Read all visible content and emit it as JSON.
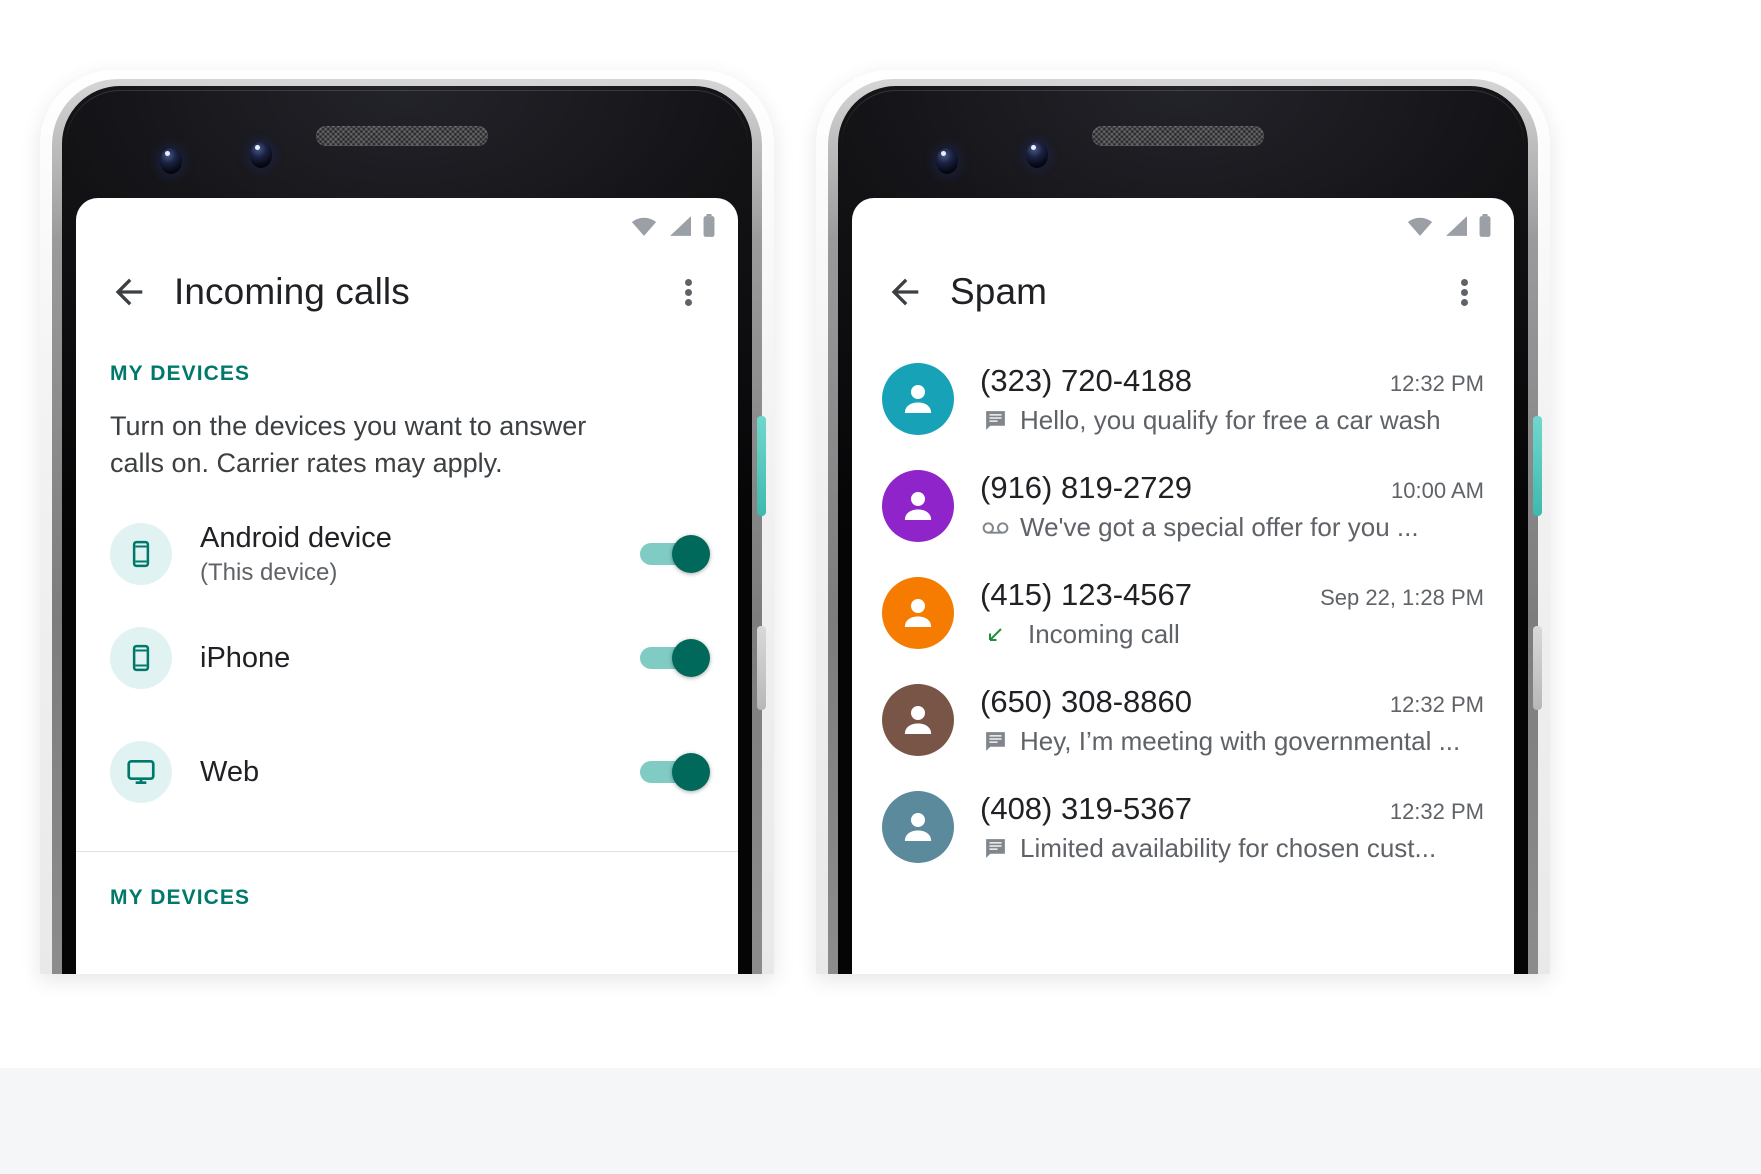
{
  "colors": {
    "accent_teal": "#00796b",
    "toggle_track": "#80cbc4",
    "toggle_thumb": "#00695c",
    "icon_bg": "#e0f2f1",
    "text_primary": "#202124",
    "text_secondary": "#5f6368",
    "incoming_arrow_green": "#1e8e3e"
  },
  "status_bar": {
    "icons": [
      "wifi-icon",
      "cell-signal-icon",
      "battery-icon"
    ]
  },
  "left_phone": {
    "appbar": {
      "back_icon": "arrow-back-icon",
      "title": "Incoming calls",
      "overflow_icon": "more-vert-icon"
    },
    "section_label": "MY DEVICES",
    "description": "Turn on the devices you want to answer calls on. Carrier rates may apply.",
    "devices": [
      {
        "icon": "smartphone-icon",
        "name": "Android device",
        "sub": "(This device)",
        "toggle_on": true
      },
      {
        "icon": "smartphone-icon",
        "name": "iPhone",
        "sub": "",
        "toggle_on": true
      },
      {
        "icon": "desktop-icon",
        "name": "Web",
        "sub": "",
        "toggle_on": true
      }
    ],
    "second_section_label": "MY DEVICES"
  },
  "right_phone": {
    "appbar": {
      "back_icon": "arrow-back-icon",
      "title": "Spam",
      "overflow_icon": "more-vert-icon"
    },
    "spam_entries": [
      {
        "number": "(323) 720-4188",
        "time": "12:32 PM",
        "sub_icon": "sms-message-icon",
        "sub_text": "Hello, you qualify for free a car wash",
        "avatar_color": "#17a2b8"
      },
      {
        "number": "(916) 819-2729",
        "time": "10:00 AM",
        "sub_icon": "voicemail-icon",
        "sub_text": "We've got a special offer for you ...",
        "avatar_color": "#8e24c9"
      },
      {
        "number": "(415) 123-4567",
        "time": "Sep 22, 1:28 PM",
        "sub_icon": "incoming-call-arrow-icon",
        "sub_text": "Incoming call",
        "avatar_color": "#f57c00"
      },
      {
        "number": "(650) 308-8860",
        "time": "12:32 PM",
        "sub_icon": "sms-message-icon",
        "sub_text": "Hey, I’m meeting with governmental ...",
        "avatar_color": "#795548"
      },
      {
        "number": "(408) 319-5367",
        "time": "12:32 PM",
        "sub_icon": "sms-message-icon",
        "sub_text": "Limited availability for chosen cust...",
        "avatar_color": "#5b8a9c"
      }
    ]
  }
}
